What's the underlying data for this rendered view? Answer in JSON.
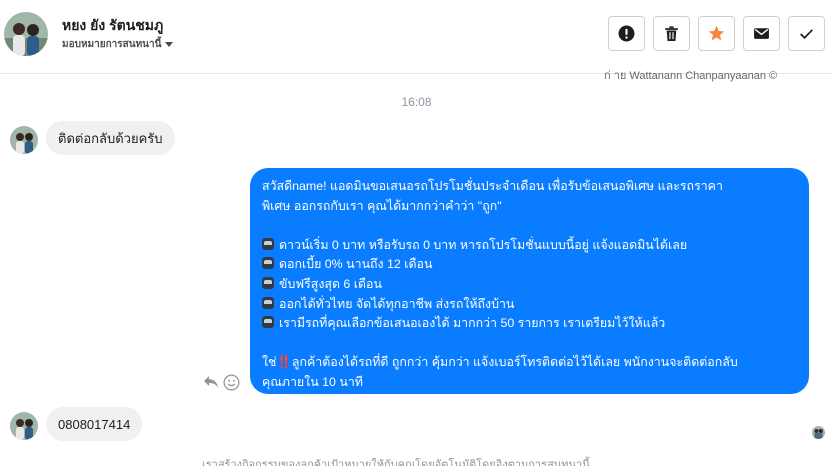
{
  "header": {
    "contact_name": "หยง ยัง รัตนชมภู",
    "assign_label": "มอบหมายการสนทนานี้",
    "actions": [
      {
        "name": "mark-spam-button",
        "icon": "alert-circle-icon"
      },
      {
        "name": "delete-button",
        "icon": "trash-icon"
      },
      {
        "name": "star-button",
        "icon": "star-icon"
      },
      {
        "name": "mark-unread-button",
        "icon": "envelope-icon"
      },
      {
        "name": "mark-done-button",
        "icon": "check-icon"
      }
    ]
  },
  "conversation": {
    "clipped_text": "ก่ าย Wattanann Chanpanyaanan ©",
    "timestamp": "16:08",
    "incoming_1": "ติดต่อกลับด้วยครับ",
    "outgoing": {
      "line1": "สวัสดีname! แอดมินขอเสนอรถโปรโมชั่นประจำเดือน เพื่อรับข้อเสนอพิเศษ และรถราคา",
      "line2": "พิเศษ ออกรถกับเรา คุณได้มากกว่าคำว่า \"ถูก\"",
      "bullet1": "ดาวน์เริ่ม 0 บาท หรือรับรถ 0 บาท หารถโปรโมชั่นแบบนี้อยู่ แจ้งแอดมินได้เลย",
      "bullet2": "ดอกเบี้ย 0% นานถึง 12 เดือน",
      "bullet3": "ขับฟรีสูงสุด 6 เดือน",
      "bullet4": "ออกได้ทั่วไทย จัดได้ทุกอาชีพ ส่งรถให้ถึงบ้าน",
      "bullet5": "เรามีรถที่คุณเลือกข้อเสนอเองได้ มากกว่า 50 รายการ เราเตรียมไว้ให้แล้ว",
      "closing_prefix": "ใช่",
      "closing_bang": "‼️",
      "closing_rest": "ลูกค้าต้องได้รถที่ดี ถูกกว่า คุ้มกว่า แจ้งเบอร์โทรติดต่อไว้ได้เลย พนักงานจะติดต่อกลับ",
      "closing_line2": "คุณภายใน 10 นาที"
    },
    "incoming_2": "0808017414",
    "footer_note": "เราสร้างกิจกรรมของลูกค้าเป้าหมายให้กับคุณโดยอัตโนมัติโดยอิงตามการสนทนานี้"
  },
  "colors": {
    "accent_blue": "#0a7cff",
    "star_orange": "#f5853f",
    "incoming_bg": "#f0f0f0"
  }
}
